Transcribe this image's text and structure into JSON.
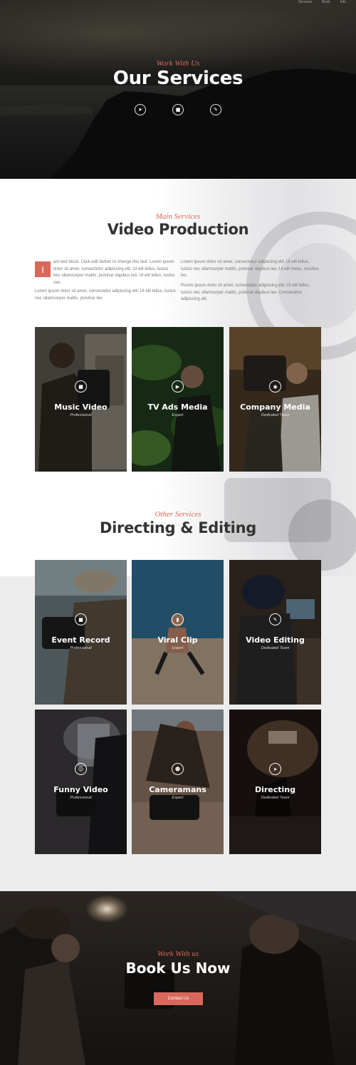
{
  "topnav": {
    "items": [
      "Services",
      "Book",
      "Info"
    ]
  },
  "hero": {
    "subtitle": "Work With Us",
    "title": "Our Services",
    "icons": [
      "megaphone-icon",
      "video-camera-icon",
      "pencil-icon"
    ]
  },
  "main_services": {
    "subtitle": "Main Services",
    "title": "Video Production",
    "dropcap": "I",
    "col1_p1": "am text block. Click edit button to change this text. Lorem ipsum dolor sit amet, consectetur adipiscing elit. Ut elit tellus, luctus nec ullamcorper mattis, pulvinar dapibus leo. Ut elit tellus, luctus nec.",
    "col1_p2": "Lorem ipsum dolor sit amet, consectetur adipiscing elit. Ut elit tellus, luctus nec ullamcorper mattis, pulvinar leo.",
    "col2_p1": "Lorem ipsum dolor sit amet, consectetur adipiscing elit. Ut elit tellus, luctus nec ullamcorper mattis, pulvinar dapibus leo. Ut elit meas, mucttus lec.",
    "col2_p2": "Purem ipsum dolor sit amet, consectetur adipiscing elit. Ut elit tellus, luctus nec ullamcorper mattis, pulvinar dapibus leo. Consectetur adipiscing elit.",
    "cards": [
      {
        "title": "Music Video",
        "sub": "Professional",
        "icon": "video-camera-icon"
      },
      {
        "title": "TV Ads Media",
        "sub": "Expert",
        "icon": "play-icon"
      },
      {
        "title": "Company Media",
        "sub": "Dedicated Team",
        "icon": "eye-icon"
      }
    ]
  },
  "other_services": {
    "subtitle": "Other Services",
    "title": "Directing & Editing",
    "cards": [
      {
        "title": "Event Record",
        "sub": "Professional",
        "icon": "video-camera-icon"
      },
      {
        "title": "Viral Clip",
        "sub": "Expert",
        "icon": "mobile-icon"
      },
      {
        "title": "Video Editing",
        "sub": "Dedicated Team",
        "icon": "pencil-icon"
      },
      {
        "title": "Funny Video",
        "sub": "Professional",
        "icon": "smile-icon"
      },
      {
        "title": "Cameramans",
        "sub": "Expert",
        "icon": "user-camera-icon"
      },
      {
        "title": "Directing",
        "sub": "Dedicated Team",
        "icon": "megaphone-icon"
      }
    ]
  },
  "book": {
    "subtitle": "Work With us",
    "title": "Book Us Now",
    "button": "Contact Us"
  },
  "colors": {
    "accent": "#d9685a",
    "heading": "#333333",
    "gray_bg": "#ececec"
  }
}
